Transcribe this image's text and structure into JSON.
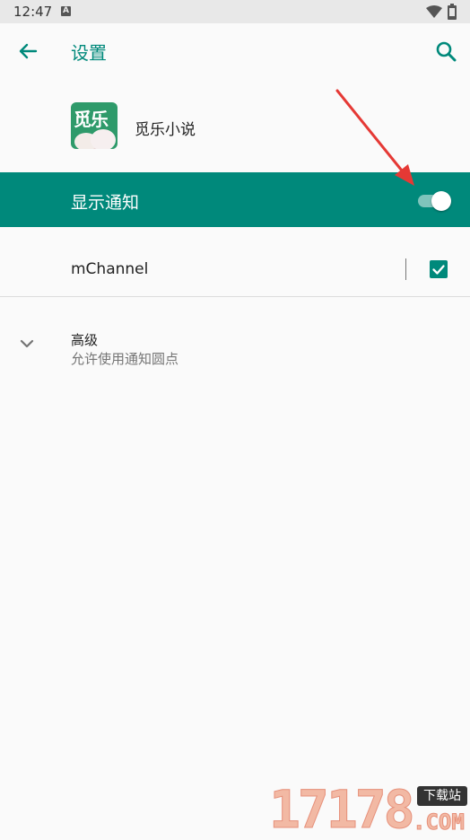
{
  "status_bar": {
    "time": "12:47",
    "notif_letter": "A"
  },
  "toolbar": {
    "title": "设置"
  },
  "app": {
    "name": "觅乐小说",
    "icon_text": "觅乐"
  },
  "master_switch": {
    "label": "显示通知",
    "enabled": true
  },
  "channel": {
    "label": "mChannel",
    "checked": true
  },
  "advanced": {
    "title": "高级",
    "subtitle": "允许使用通知圆点"
  },
  "watermark": {
    "digits": "17178",
    "badge": "下载站",
    "suffix": ".COM"
  },
  "colors": {
    "accent": "#00897b",
    "annotation": "#e53935"
  }
}
